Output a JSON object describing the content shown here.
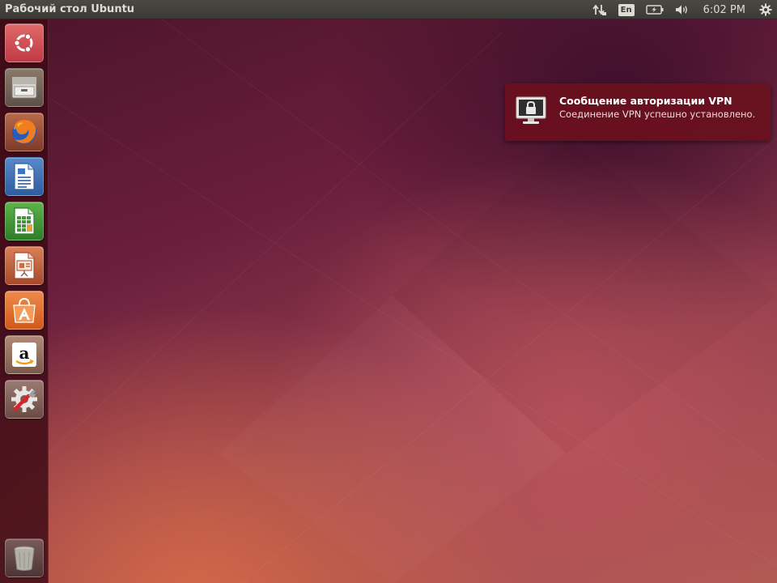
{
  "panel": {
    "title": "Рабочий стол Ubuntu",
    "clock": "6:02 PM",
    "keyboard_layout": "En",
    "indicators": [
      "network-icon",
      "keyboard-layout-indicator",
      "battery-icon",
      "volume-icon",
      "session-gear-icon"
    ]
  },
  "launcher": {
    "items": [
      {
        "name": "dash-home",
        "icon": "ubuntu-logo-icon"
      },
      {
        "name": "files",
        "icon": "file-cabinet-icon"
      },
      {
        "name": "firefox",
        "icon": "firefox-icon"
      },
      {
        "name": "libreoffice-writer",
        "icon": "document-icon"
      },
      {
        "name": "libreoffice-calc",
        "icon": "spreadsheet-icon"
      },
      {
        "name": "libreoffice-impress",
        "icon": "presentation-icon"
      },
      {
        "name": "software-center",
        "icon": "shopping-bag-icon"
      },
      {
        "name": "amazon",
        "icon": "amazon-icon"
      },
      {
        "name": "system-settings",
        "icon": "settings-wrench-icon"
      },
      {
        "name": "trash",
        "icon": "trash-icon"
      }
    ]
  },
  "notification": {
    "title": "Сообщение авторизации VPN",
    "body": "Соединение VPN успешно установлено.",
    "icon": "lock-monitor-icon"
  },
  "colors": {
    "panel_bg": "#3b3a36",
    "launcher_bg": "#3c0a14",
    "notification_bg": "#69111e",
    "accent_orange": "#e95420"
  }
}
